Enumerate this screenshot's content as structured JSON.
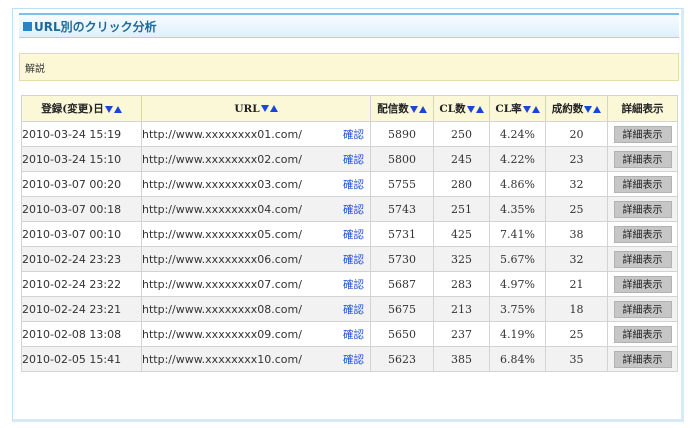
{
  "panel": {
    "title": "URL別のクリック分析",
    "note": "解説"
  },
  "table": {
    "headers": {
      "date": "登録(変更)日",
      "url": "URL",
      "delivered": "配信数",
      "cl_count": "CL数",
      "cl_rate": "CL率",
      "conversions": "成約数",
      "detail": "詳細表示"
    },
    "confirm_label": "確認",
    "detail_button_label": "詳細表示",
    "rows": [
      {
        "date": "2010-03-24 15:19",
        "url": "http://www.xxxxxxxx01.com/",
        "delivered": "5890",
        "cl_count": "250",
        "cl_rate": "4.24%",
        "conversions": "20"
      },
      {
        "date": "2010-03-24 15:10",
        "url": "http://www.xxxxxxxx02.com/",
        "delivered": "5800",
        "cl_count": "245",
        "cl_rate": "4.22%",
        "conversions": "23"
      },
      {
        "date": "2010-03-07 00:20",
        "url": "http://www.xxxxxxxx03.com/",
        "delivered": "5755",
        "cl_count": "280",
        "cl_rate": "4.86%",
        "conversions": "32"
      },
      {
        "date": "2010-03-07 00:18",
        "url": "http://www.xxxxxxxx04.com/",
        "delivered": "5743",
        "cl_count": "251",
        "cl_rate": "4.35%",
        "conversions": "25"
      },
      {
        "date": "2010-03-07 00:10",
        "url": "http://www.xxxxxxxx05.com/",
        "delivered": "5731",
        "cl_count": "425",
        "cl_rate": "7.41%",
        "conversions": "38"
      },
      {
        "date": "2010-02-24 23:23",
        "url": "http://www.xxxxxxxx06.com/",
        "delivered": "5730",
        "cl_count": "325",
        "cl_rate": "5.67%",
        "conversions": "32"
      },
      {
        "date": "2010-02-24 23:22",
        "url": "http://www.xxxxxxxx07.com/",
        "delivered": "5687",
        "cl_count": "283",
        "cl_rate": "4.97%",
        "conversions": "21"
      },
      {
        "date": "2010-02-24 23:21",
        "url": "http://www.xxxxxxxx08.com/",
        "delivered": "5675",
        "cl_count": "213",
        "cl_rate": "3.75%",
        "conversions": "18"
      },
      {
        "date": "2010-02-08 13:08",
        "url": "http://www.xxxxxxxx09.com/",
        "delivered": "5650",
        "cl_count": "237",
        "cl_rate": "4.19%",
        "conversions": "25"
      },
      {
        "date": "2010-02-05 15:41",
        "url": "http://www.xxxxxxxx10.com/",
        "delivered": "5623",
        "cl_count": "385",
        "cl_rate": "6.84%",
        "conversions": "35"
      }
    ]
  },
  "icons": {
    "title": "blue-square-icon",
    "sort_descending": "sort-descending-icon",
    "sort_ascending": "sort-ascending-icon"
  },
  "colors": {
    "title_text": "#1d6a99",
    "title_square": "#2a83c6",
    "note_background": "#fcf8d6",
    "header_background": "#fbf8d8",
    "sort_arrow": "#1a45d8",
    "confirm_link": "#1d4fd8",
    "detail_button": "#c6c6c6"
  }
}
